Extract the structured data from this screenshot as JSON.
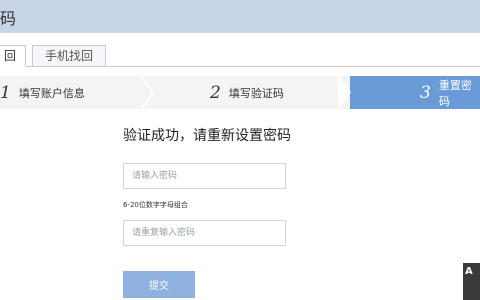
{
  "window": {
    "title": "码"
  },
  "tabs": [
    {
      "label": "回",
      "active": true
    },
    {
      "label": "手机找回",
      "active": false
    }
  ],
  "steps": [
    {
      "num": "1",
      "label": "填写账户信息",
      "active": false
    },
    {
      "num": "2",
      "label": "填写验证码",
      "active": false
    },
    {
      "num": "3",
      "label": "重置密码",
      "active": true
    }
  ],
  "form": {
    "title": "验证成功，请重新设置密码",
    "password_placeholder": "请输入密码",
    "hint": "6-20位数字字母组合",
    "confirm_placeholder": "请重复输入密码",
    "submit_label": "提交"
  },
  "corner": {
    "label": "A"
  },
  "colors": {
    "titlebar": "#c8d5e8",
    "active_step": "#6a9bd8",
    "submit": "#8fb1df"
  }
}
